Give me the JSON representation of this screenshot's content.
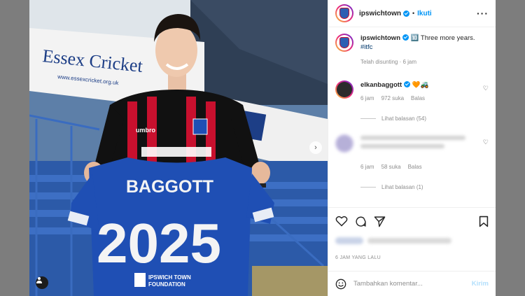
{
  "header": {
    "username": "ipswichtown",
    "separator": "•",
    "follow_label": "Ikuti",
    "more_icon": "more-dots-icon"
  },
  "caption": {
    "username": "ipswichtown",
    "text": "🔟 Three more years.",
    "hashtag": "#itfc",
    "edited": "Telah disunting · 6 jam"
  },
  "comments": [
    {
      "username": "elkanbaggott",
      "text": "🧡🚜",
      "time": "6 jam",
      "likes": "972 suka",
      "reply": "Balas",
      "view_replies": "Lihat balasan (54)"
    },
    {
      "username": "",
      "text": "",
      "time": "6 jam",
      "likes": "58 suka",
      "reply": "Balas",
      "view_replies": "Lihat balasan (1)"
    }
  ],
  "footer": {
    "timestamp": "6 JAM YANG LALU",
    "add_comment_placeholder": "Tambahkan komentar...",
    "send_label": "Kirim"
  },
  "photo": {
    "banner_text": "Essex Cricket",
    "banner_url": "www.essexcricket.org.uk",
    "shirt_name": "BAGGOTT",
    "shirt_number": "2025",
    "foundation_text_1": "IPSWICH TOWN",
    "foundation_text_2": "FOUNDATION",
    "kit_brand": "umbro"
  },
  "colors": {
    "accent": "#0095f6",
    "shirt_blue": "#1f4fb4",
    "home_red": "#c8102e"
  }
}
